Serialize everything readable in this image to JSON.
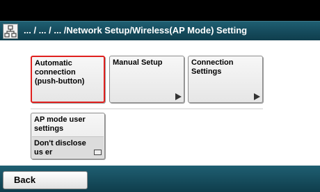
{
  "header": {
    "title": "... / ... / ... /Network Setup/Wireless(AP Mode) Setting",
    "icon": "network-icon"
  },
  "tiles": [
    {
      "label": "Automatic connection (push-button)",
      "selected": true
    },
    {
      "label": "Manual Setup"
    },
    {
      "label": "Connection Settings"
    }
  ],
  "ap_mode": {
    "label": "AP mode user settings",
    "value": "Don't disclose us er"
  },
  "footer": {
    "back_label": "Back"
  },
  "colors": {
    "header_bar": "#154a5b",
    "selected_border": "#e0201e"
  }
}
